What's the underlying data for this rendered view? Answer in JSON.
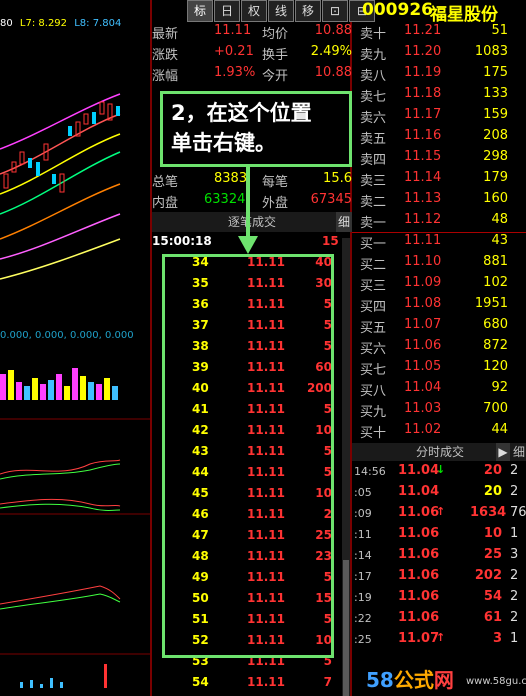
{
  "chart": {
    "top_info": [
      "80",
      "L7: 8.292",
      "L8: 7.804"
    ],
    "ma_text": "0.000, 0.000, 0.000, 0.000"
  },
  "tabs": [
    "标",
    "日",
    "权",
    "线",
    "移",
    "⊡",
    "⊟"
  ],
  "stock": {
    "code": "000926",
    "name": "福星股份"
  },
  "quote": [
    {
      "label": "最新",
      "value": "11.11",
      "label2": "均价",
      "value2": "10.88"
    },
    {
      "label": "涨跌",
      "value": "+0.21",
      "label2": "换手",
      "value2": "2.49%"
    },
    {
      "label": "涨幅",
      "value": "1.93%",
      "label2": "今开",
      "value2": "10.88"
    },
    {
      "label": "总笔",
      "value": "8383",
      "label2": "每笔",
      "value2": "15.6"
    },
    {
      "label": "内盘",
      "value": "63324",
      "label2": "外盘",
      "value2": "67345"
    }
  ],
  "trades_header": {
    "title": "逐笔成交",
    "detail": "细"
  },
  "trades_first_time": "15:00:18",
  "trades_first_vol": "15",
  "trades": [
    {
      "n": "34",
      "p": "11.11",
      "q": "40"
    },
    {
      "n": "35",
      "p": "11.11",
      "q": "30"
    },
    {
      "n": "36",
      "p": "11.11",
      "q": "5"
    },
    {
      "n": "37",
      "p": "11.11",
      "q": "5"
    },
    {
      "n": "38",
      "p": "11.11",
      "q": "5"
    },
    {
      "n": "39",
      "p": "11.11",
      "q": "60"
    },
    {
      "n": "40",
      "p": "11.11",
      "q": "200"
    },
    {
      "n": "41",
      "p": "11.11",
      "q": "5"
    },
    {
      "n": "42",
      "p": "11.11",
      "q": "10"
    },
    {
      "n": "43",
      "p": "11.11",
      "q": "5"
    },
    {
      "n": "44",
      "p": "11.11",
      "q": "5"
    },
    {
      "n": "45",
      "p": "11.11",
      "q": "10"
    },
    {
      "n": "46",
      "p": "11.11",
      "q": "2"
    },
    {
      "n": "47",
      "p": "11.11",
      "q": "25"
    },
    {
      "n": "48",
      "p": "11.11",
      "q": "23"
    },
    {
      "n": "49",
      "p": "11.11",
      "q": "5"
    },
    {
      "n": "50",
      "p": "11.11",
      "q": "15"
    },
    {
      "n": "51",
      "p": "11.11",
      "q": "5"
    },
    {
      "n": "52",
      "p": "11.11",
      "q": "10"
    },
    {
      "n": "53",
      "p": "11.11",
      "q": "5"
    },
    {
      "n": "54",
      "p": "11.11",
      "q": "7"
    }
  ],
  "sell_orders": [
    {
      "label": "卖十",
      "price": "11.21",
      "vol": "51"
    },
    {
      "label": "卖九",
      "price": "11.20",
      "vol": "1083"
    },
    {
      "label": "卖八",
      "price": "11.19",
      "vol": "175"
    },
    {
      "label": "卖七",
      "price": "11.18",
      "vol": "133"
    },
    {
      "label": "卖六",
      "price": "11.17",
      "vol": "159"
    },
    {
      "label": "卖五",
      "price": "11.16",
      "vol": "208"
    },
    {
      "label": "卖四",
      "price": "11.15",
      "vol": "298"
    },
    {
      "label": "卖三",
      "price": "11.14",
      "vol": "179"
    },
    {
      "label": "卖二",
      "price": "11.13",
      "vol": "160"
    },
    {
      "label": "卖一",
      "price": "11.12",
      "vol": "48"
    }
  ],
  "buy_orders": [
    {
      "label": "买一",
      "price": "11.11",
      "vol": "43"
    },
    {
      "label": "买二",
      "price": "11.10",
      "vol": "881"
    },
    {
      "label": "买三",
      "price": "11.09",
      "vol": "102"
    },
    {
      "label": "买四",
      "price": "11.08",
      "vol": "1951"
    },
    {
      "label": "买五",
      "price": "11.07",
      "vol": "680"
    },
    {
      "label": "买六",
      "price": "11.06",
      "vol": "872"
    },
    {
      "label": "买七",
      "price": "11.05",
      "vol": "120"
    },
    {
      "label": "买八",
      "price": "11.04",
      "vol": "92"
    },
    {
      "label": "买九",
      "price": "11.03",
      "vol": "700"
    },
    {
      "label": "买十",
      "price": "11.02",
      "vol": "44"
    }
  ],
  "fenshi_header": {
    "title": "分时成交",
    "detail": "细"
  },
  "fenshi": [
    {
      "time": "14:56",
      "price": "11.04",
      "arrow": "↓",
      "arrow_color": "#00e000",
      "vol": "20",
      "vol_color": "#ff3333",
      "side": "2"
    },
    {
      "time": ":05",
      "price": "11.04",
      "arrow": "",
      "arrow_color": "#00e000",
      "vol": "20",
      "vol_color": "#ffff00",
      "side": "2"
    },
    {
      "time": ":09",
      "price": "11.06",
      "arrow": "↑",
      "arrow_color": "#ff3333",
      "vol": "1634",
      "vol_color": "#ff3333",
      "side": "76"
    },
    {
      "time": ":11",
      "price": "11.06",
      "arrow": "",
      "arrow_color": "#ff3333",
      "vol": "10",
      "vol_color": "#ff3333",
      "side": "1"
    },
    {
      "time": ":14",
      "price": "11.06",
      "arrow": "",
      "arrow_color": "#ff3333",
      "vol": "25",
      "vol_color": "#ff3333",
      "side": "3"
    },
    {
      "time": ":17",
      "price": "11.06",
      "arrow": "",
      "arrow_color": "#ff3333",
      "vol": "202",
      "vol_color": "#ff3333",
      "side": "2"
    },
    {
      "time": ":19",
      "price": "11.06",
      "arrow": "",
      "arrow_color": "#ff3333",
      "vol": "54",
      "vol_color": "#ff3333",
      "side": "2"
    },
    {
      "time": ":22",
      "price": "11.06",
      "arrow": "",
      "arrow_color": "#ff3333",
      "vol": "61",
      "vol_color": "#ff3333",
      "side": "2"
    },
    {
      "time": ":25",
      "price": "11.07",
      "arrow": "↑",
      "arrow_color": "#ff3333",
      "vol": "3",
      "vol_color": "#ff3333",
      "side": "1"
    }
  ],
  "annotation": {
    "line1": "2，在这个位置",
    "line2": "单击右键。"
  },
  "watermark": {
    "prefix": "58",
    "middle": "公式",
    "suffix": "网",
    "url": "www.58gu.com"
  }
}
